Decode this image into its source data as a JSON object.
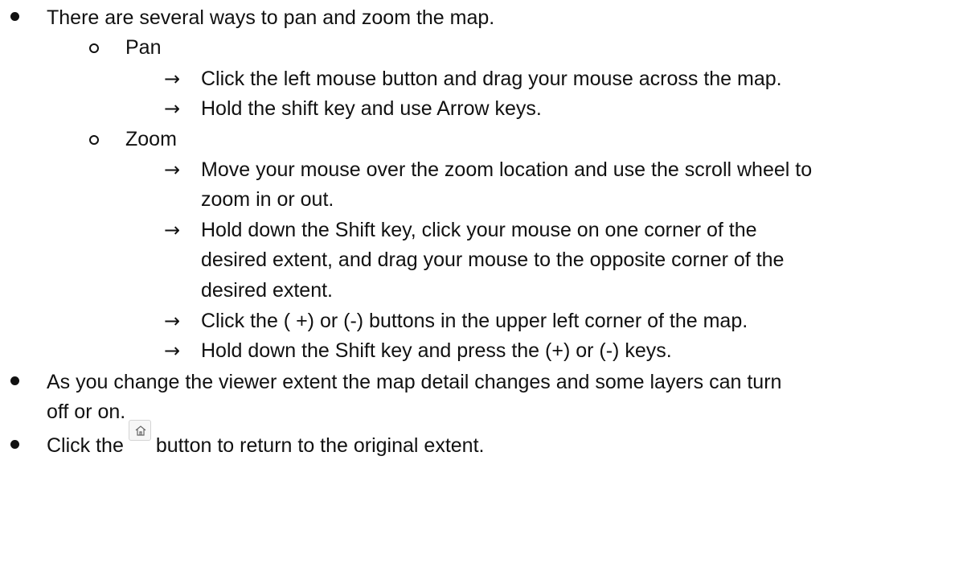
{
  "bullets": [
    "There are several ways to pan and zoom the map.",
    "As you change the viewer extent the map detail changes and some layers can turn",
    "off or on.",
    "Click the",
    "button to return to the original extent."
  ],
  "pan": {
    "label": "Pan",
    "items": [
      "Click the left mouse button and drag your mouse across the map.",
      "Hold the shift key and use Arrow keys."
    ]
  },
  "zoom": {
    "label": "Zoom",
    "items": [
      "Move your mouse over the zoom location and use the scroll wheel to",
      "zoom in or out.",
      "Hold down the Shift key, click your mouse on one corner of the",
      "desired extent, and drag your mouse to the opposite corner of the",
      "desired extent.",
      "Click the ( +) or (-) buttons in the upper left corner of the map.",
      "Hold down the Shift key and press the (+) or (-) keys."
    ]
  },
  "icons": {
    "bullet": "filled-circle-bullet",
    "sub_bullet": "hollow-circle-bullet",
    "arrow": "right-arrow",
    "home": "home-icon"
  },
  "colors": {
    "text": "#111111"
  }
}
